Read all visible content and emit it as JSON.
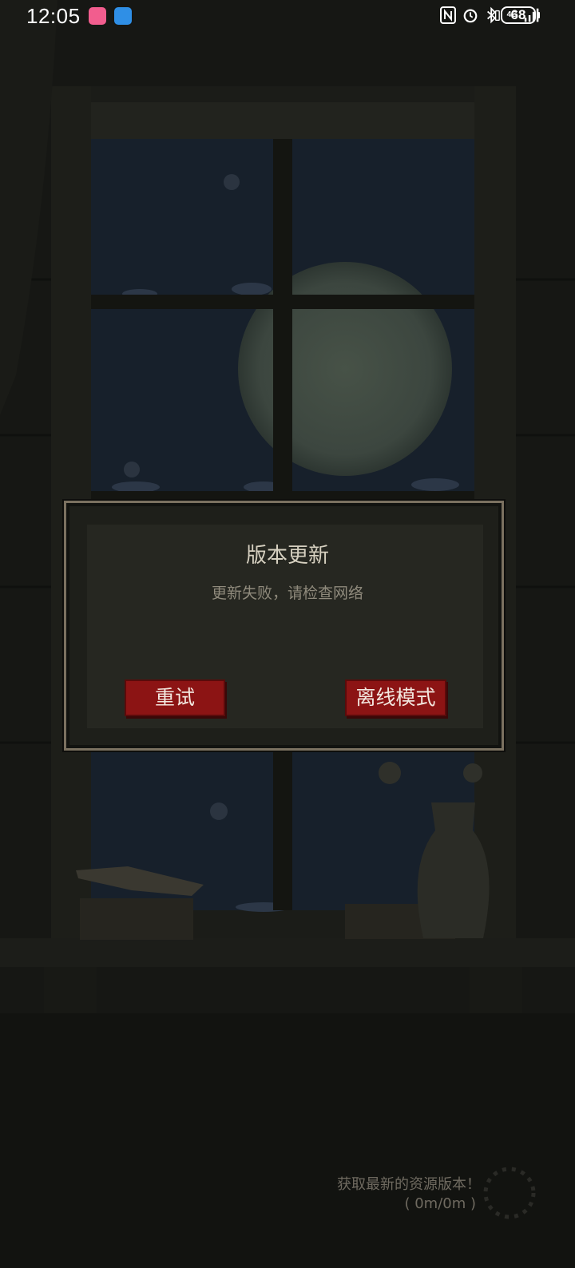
{
  "status_bar": {
    "time": "12:05",
    "network": "4G",
    "battery": "68",
    "icons": [
      "bilibili-app-icon",
      "weather-app-icon",
      "nfc-icon",
      "alarm-icon",
      "bluetooth-icon",
      "signal-icon"
    ]
  },
  "dialog": {
    "title": "版本更新",
    "message": "更新失败，请检查网络",
    "retry_label": "重试",
    "offline_label": "离线模式"
  },
  "loading": {
    "text": "获取最新的资源版本！",
    "progress": "( 0m/0m )"
  },
  "colors": {
    "button_red": "#8c1414",
    "dialog_bg": "#262721",
    "dialog_border": "#7b7160",
    "night_sky": "#17202b",
    "moon": "#3f4a41"
  }
}
